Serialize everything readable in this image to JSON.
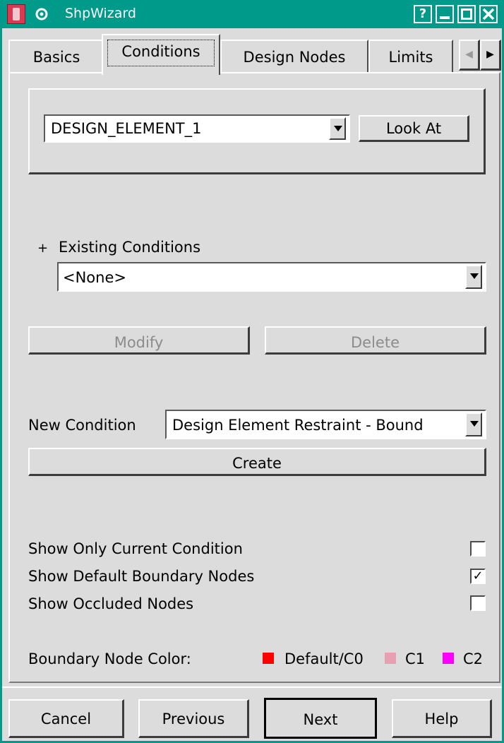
{
  "window": {
    "title": "ShpWizard",
    "controls": {
      "help": "?",
      "minimize": "_",
      "maximize": "□",
      "close": "✕"
    }
  },
  "tabs": [
    {
      "label": "Basics"
    },
    {
      "label": "Conditions"
    },
    {
      "label": "Design Nodes"
    },
    {
      "label": "Limits"
    }
  ],
  "tab_scroll": {
    "left": "◀",
    "right": "▶"
  },
  "element": {
    "selected": "DESIGN_ELEMENT_1",
    "look_at_label": "Look At"
  },
  "existing": {
    "expander": "+",
    "label": "Existing Conditions",
    "selected": "<None>",
    "modify_label": "Modify",
    "delete_label": "Delete"
  },
  "new_condition": {
    "label": "New Condition",
    "selected": "Design Element Restraint - Bound",
    "create_label": "Create"
  },
  "options": [
    {
      "label": "Show Only Current Condition",
      "checked": false
    },
    {
      "label": "Show Default Boundary Nodes",
      "checked": true
    },
    {
      "label": "Show Occluded Nodes",
      "checked": false
    }
  ],
  "check_mark": "✓",
  "boundary_color": {
    "label": "Boundary Node Color:",
    "items": [
      {
        "label": "Default/C0",
        "color": "#ff0000"
      },
      {
        "label": "C1",
        "color": "#e8a0b0"
      },
      {
        "label": "C2",
        "color": "#ff00ff"
      }
    ]
  },
  "footer": {
    "cancel": "Cancel",
    "previous": "Previous",
    "next": "Next",
    "help": "Help"
  }
}
